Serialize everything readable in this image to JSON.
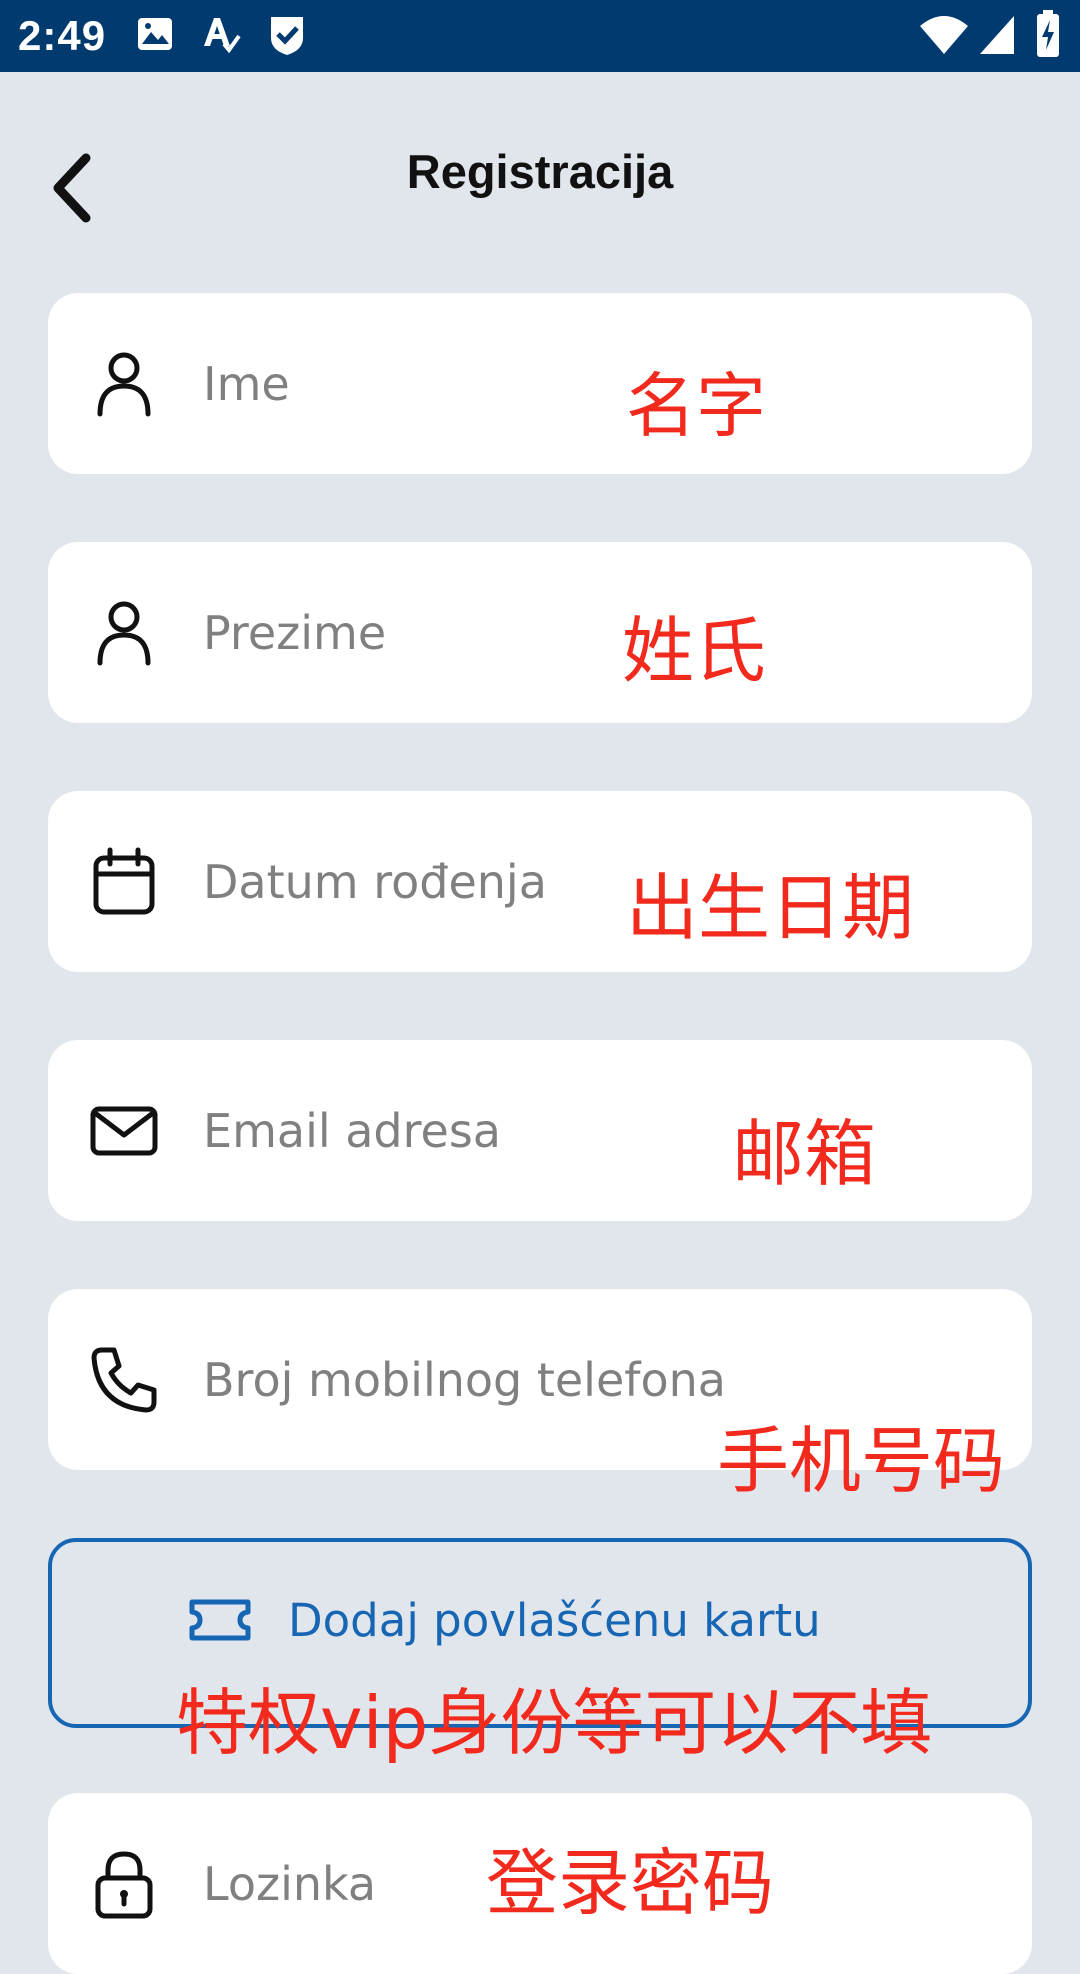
{
  "status_bar": {
    "time": "2:49",
    "icons": [
      "image-icon",
      "text-autocorrect-icon",
      "check-shield-icon",
      "wifi-icon",
      "cell-signal-icon",
      "battery-charging-icon"
    ]
  },
  "header": {
    "title": "Registracija",
    "back_icon": "chevron-left-icon"
  },
  "form": {
    "fields": [
      {
        "name": "first-name",
        "placeholder": "Ime",
        "icon": "person-icon",
        "annotation": "名字"
      },
      {
        "name": "last-name",
        "placeholder": "Prezime",
        "icon": "person-icon",
        "annotation": "姓氏"
      },
      {
        "name": "birth-date",
        "placeholder": "Datum rođenja",
        "icon": "calendar-icon",
        "annotation": "出生日期"
      },
      {
        "name": "email",
        "placeholder": "Email adresa",
        "icon": "envelope-icon",
        "annotation": "邮箱"
      },
      {
        "name": "phone",
        "placeholder": "Broj mobilnog telefona",
        "icon": "phone-icon",
        "annotation": "手机号码"
      },
      {
        "name": "password",
        "placeholder": "Lozinka",
        "icon": "lock-icon",
        "annotation": "登录密码"
      }
    ],
    "card_button": {
      "label": "Dodaj povlašćenu kartu",
      "icon": "ticket-icon",
      "annotation": "特权vip身份等可以不填"
    }
  },
  "colors": {
    "status_bar": "#003a6e",
    "background": "#e1e6ec",
    "accent": "#1766b4",
    "annotation": "#f22a1e"
  }
}
